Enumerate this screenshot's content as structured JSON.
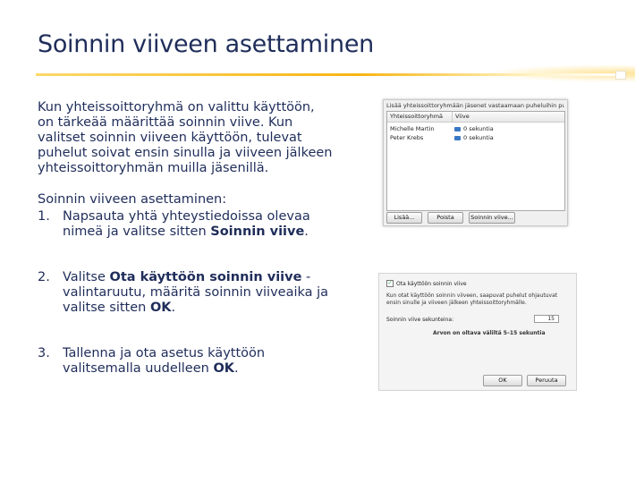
{
  "slide": {
    "title": "Soinnin viiveen asettaminen",
    "intro": "Kun yhteissoittoryhmä on valittu käyttöön, on tärkeää määrittää soinnin viive. Kun valitset soinnin viiveen käyttöön, tulevat puhelut soivat ensin sinulla ja viiveen jälkeen yhteissoittoryhmän muilla jäsenillä.",
    "steps_heading": "Soinnin viiveen asettaminen:",
    "steps": [
      {
        "num": "1.",
        "pre": "Napsauta yhtä yhteystiedoissa olevaa nimeä ja valitse sitten ",
        "bold": "Soinnin viive",
        "mid": ".",
        "bold2": "",
        "post": ""
      },
      {
        "num": "2.",
        "pre": "Valitse ",
        "bold": "Ota käyttöön soinnin viive",
        "mid": " -valintaruutu, määritä soinnin viiveaika ja valitse sitten ",
        "bold2": "OK",
        "post": "."
      },
      {
        "num": "3.",
        "pre": "Tallenna ja ota asetus käyttöön valitsemalla uudelleen ",
        "bold": "OK",
        "mid": ".",
        "bold2": "",
        "post": ""
      }
    ]
  },
  "screenshot1": {
    "top_text": "Lisää yhteissoittoryhmään jäsenet vastaamaan puheluihin puolestasi",
    "columns": [
      "Yhteissoittoryhmä",
      "Viive"
    ],
    "rows": [
      {
        "name": "Michelle Martin",
        "delay": "0 sekuntia"
      },
      {
        "name": "Peter Krebs",
        "delay": "0 sekuntia"
      }
    ],
    "buttons": {
      "add": "Lisää...",
      "remove": "Poista",
      "delay": "Soinnin viive..."
    }
  },
  "screenshot2": {
    "checkbox_label": "Ota käyttöön soinnin viive",
    "description": "Kun otat käyttöön soinnin viiveen, saapuvat puhelut ohjautuvat ensin sinulle ja viiveen jälkeen yhteissoittoryhmälle.",
    "field_label": "Soinnin viive sekunteina:",
    "field_value": "15",
    "hint": "Arvon on oltava väliltä 5–15 sekuntia",
    "buttons": {
      "ok": "OK",
      "cancel": "Peruuta"
    }
  }
}
